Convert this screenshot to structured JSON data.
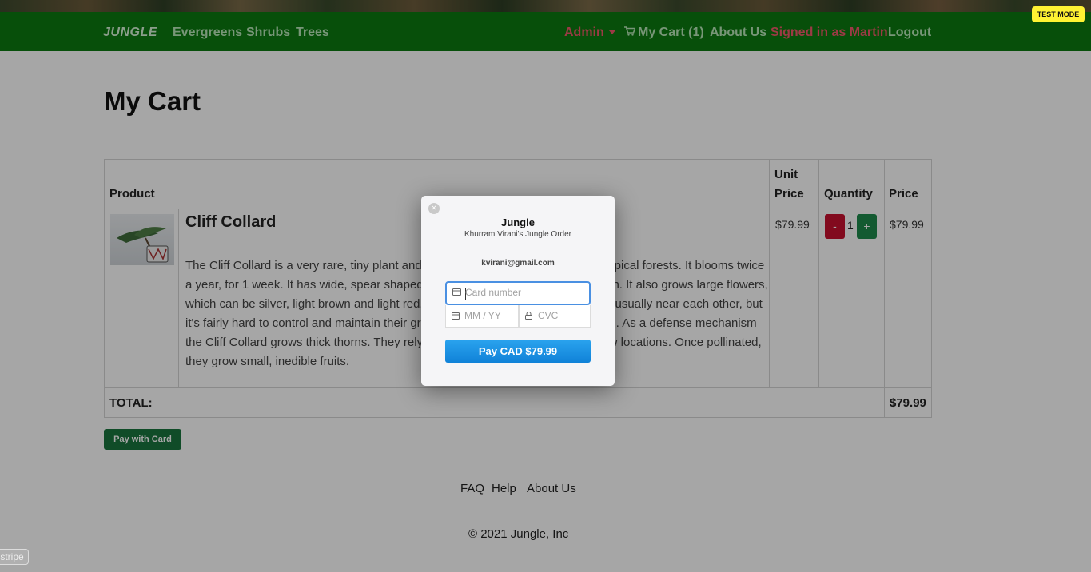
{
  "nav": {
    "brand": "JUNGLE",
    "links": [
      "Evergreens",
      "Shrubs",
      "Trees"
    ],
    "admin": "Admin",
    "cart": "My Cart (1)",
    "about": "About Us",
    "signed_in": "Signed in as Martin",
    "logout": "Logout"
  },
  "test_mode": "TEST MODE",
  "page_title": "My Cart",
  "table": {
    "headers": {
      "product": "Product",
      "unit_price_line1": "Unit",
      "unit_price_line2": "Price",
      "quantity": "Quantity",
      "price": "Price"
    },
    "row": {
      "name": "Cliff Collard",
      "description": "The Cliff Collard is a very rare, tiny plant and can be found only in some moist tropical forests. It blooms twice a year, for 1 week. It has wide, spear shaped leaves, which are usually light green. It also grows large flowers, which can be silver, light brown and light red. These plants grow in small groups, usually near each other, but it's fairly hard to control and maintain their growth. They can grow up to 90 cm tall. As a defense mechanism the Cliff Collard grows thick thorns. They rely on winds to carry their seeds to new locations. Once pollinated, they grow small, inedible fruits.",
      "unit_price": "$79.99",
      "qty_minus": "-",
      "qty": "1",
      "qty_plus": "+",
      "price": "$79.99"
    },
    "total_label": "TOTAL:",
    "total_value": "$79.99"
  },
  "pay_with_card": "Pay with Card",
  "footer": {
    "links": [
      "FAQ",
      "Help",
      "About Us"
    ],
    "copyright": "© 2021 Jungle, Inc"
  },
  "stripe_badge": "stripe",
  "modal": {
    "close": "×",
    "title": "Jungle",
    "subtitle": "Khurram Virani's Jungle Order",
    "email": "kvirani@gmail.com",
    "card_placeholder": "Card number",
    "exp_placeholder": "MM / YY",
    "cvc_placeholder": "CVC",
    "pay_button": "Pay CAD $79.99"
  },
  "colors": {
    "navbar": "#0b7a10",
    "nav_accent": "#f05a6a",
    "pay_button": "#1082d8",
    "qty_minus": "#c8102e",
    "qty_plus": "#1e8a4c",
    "pay_with_card": "#19763e"
  }
}
